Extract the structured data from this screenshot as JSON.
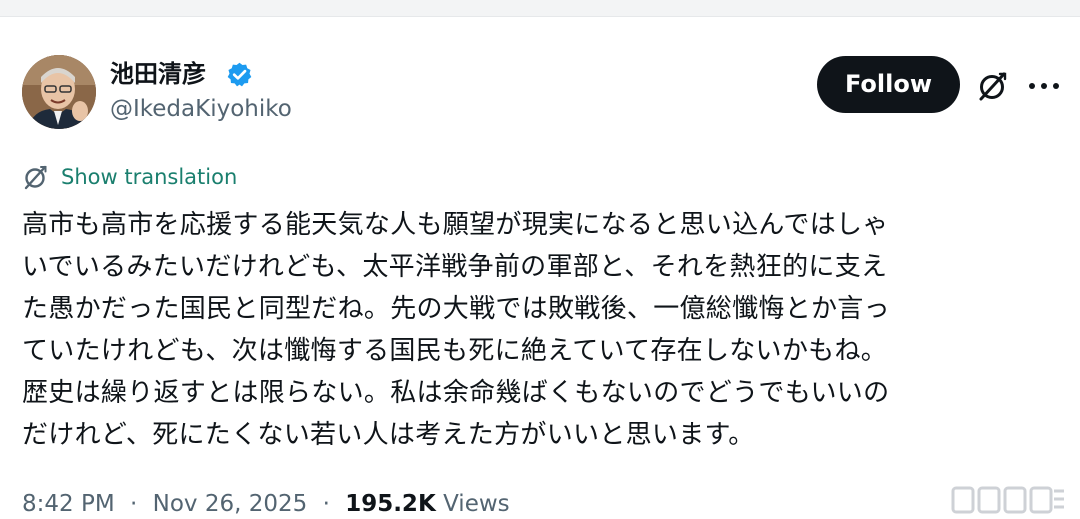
{
  "author": {
    "name": "池田清彦",
    "handle": "@IkedaKiyohiko",
    "verified": true,
    "verified_icon": "verified-badge-icon"
  },
  "actions": {
    "follow_label": "Follow",
    "grok_icon": "grok-icon",
    "more_icon": "more-icon"
  },
  "translation": {
    "label": "Show translation",
    "icon": "translate-icon"
  },
  "tweet": {
    "lines": [
      "高市も高市を応援する能天気な人も願望が現実になると思い込んではしゃ",
      "いでいるみたいだけれども、太平洋戦争前の軍部と、それを熱狂的に支え",
      "た愚かだった国民と同型だね。先の大戦では敗戦後、一億総懺悔とか言っ",
      "ていたけれども、次は懺悔する国民も死に絶えていて存在しないかもね。",
      "歴史は繰り返すとは限らない。私は余命幾ばくもないのでどうでもいいの",
      "だけれど、死にたくない若い人は考えた方がいいと思います。"
    ]
  },
  "meta": {
    "time": "8:42 PM",
    "separator": "·",
    "date": "Nov 26, 2025",
    "views_count": "195.2K",
    "views_label": "Views"
  },
  "colors": {
    "follow_bg": "#0f1419",
    "link": "#1a7f6e",
    "secondary_text": "#536471",
    "verified": "#1d9bf0"
  }
}
